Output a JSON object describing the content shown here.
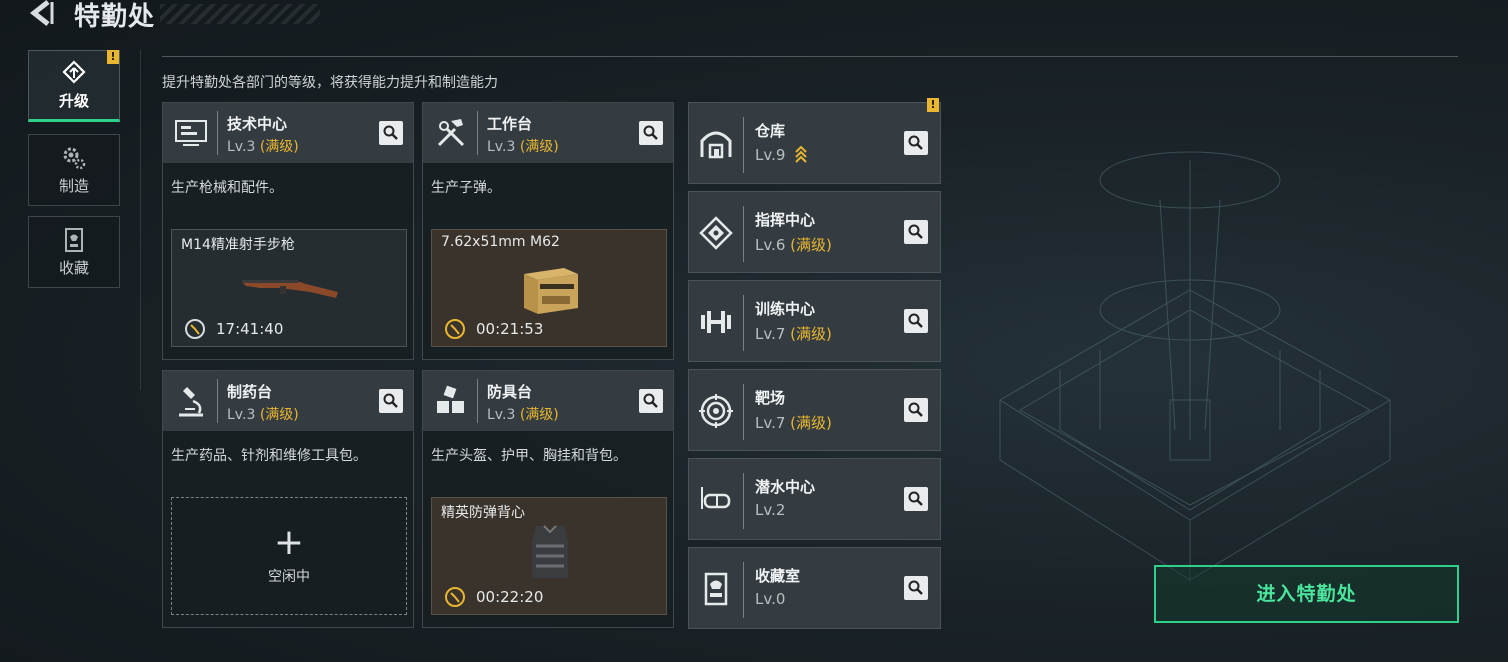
{
  "header": {
    "title": "特勤处",
    "back_icon": "back-arrow-icon"
  },
  "subtitle": "提升特勤处各部门的等级，将获得能力提升和制造能力",
  "warning_mark": "!",
  "nav": [
    {
      "label": "升级",
      "icon": "upgrade-icon",
      "active": true,
      "alert": true
    },
    {
      "label": "制造",
      "icon": "gears-icon",
      "active": false,
      "alert": false
    },
    {
      "label": "收藏",
      "icon": "collection-icon",
      "active": false,
      "alert": false
    }
  ],
  "workshops": [
    {
      "name": "技术中心",
      "level": "Lv.3",
      "max": "(满级)",
      "desc": "生产枪械和配件。",
      "slot": {
        "item": "M14精准射手步枪",
        "timer": "17:41:40"
      }
    },
    {
      "name": "工作台",
      "level": "Lv.3",
      "max": "(满级)",
      "desc": "生产子弹。",
      "slot": {
        "item": "7.62x51mm M62",
        "timer": "00:21:53"
      }
    },
    {
      "name": "制药台",
      "level": "Lv.3",
      "max": "(满级)",
      "desc": "生产药品、针剂和维修工具包。",
      "slot": {
        "idle": "空闲中",
        "plus": "+"
      }
    },
    {
      "name": "防具台",
      "level": "Lv.3",
      "max": "(满级)",
      "desc": "生产头盔、护甲、胸挂和背包。",
      "slot": {
        "item": "精英防弹背心",
        "timer": "00:22:20"
      }
    }
  ],
  "departments": [
    {
      "name": "仓库",
      "level": "Lv.9",
      "max": "",
      "alert": true,
      "icon": "warehouse-icon",
      "upgrade_available": true
    },
    {
      "name": "指挥中心",
      "level": "Lv.6",
      "max": "(满级)",
      "alert": false,
      "icon": "command-center-icon"
    },
    {
      "name": "训练中心",
      "level": "Lv.7",
      "max": "(满级)",
      "alert": false,
      "icon": "dumbbell-icon"
    },
    {
      "name": "靶场",
      "level": "Lv.7",
      "max": "(满级)",
      "alert": false,
      "icon": "target-icon"
    },
    {
      "name": "潜水中心",
      "level": "Lv.2",
      "max": "",
      "alert": false,
      "icon": "diving-mask-icon"
    },
    {
      "name": "收藏室",
      "level": "Lv.0",
      "max": "",
      "alert": false,
      "icon": "collection-room-icon"
    }
  ],
  "enter_button": "进入特勤处",
  "colors": {
    "accent_green": "#2ed08a",
    "gold": "#e8b630",
    "panel": "#343c41"
  }
}
